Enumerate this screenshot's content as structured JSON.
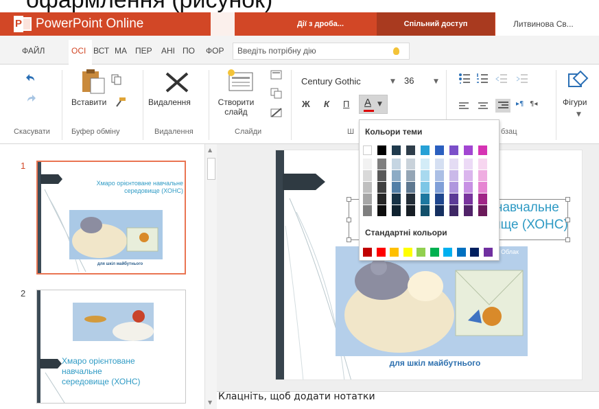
{
  "caption": "офармлення (рисунок)",
  "titlebar": {
    "app_name": "PowerPoint Online",
    "doc_button": "Дії з дроба...",
    "share_button": "Спільний доступ",
    "user": "Литвинова Св..."
  },
  "tabs": {
    "file": "ФАЙЛ",
    "home": "ОСІ",
    "others": [
      "ВСТ",
      "МА",
      "ПЕР",
      "АНІ",
      "ПО",
      "ФОР"
    ],
    "search_placeholder": "Введіть потрібну дію"
  },
  "ribbon": {
    "undo_group": "Скасувати",
    "clipboard_group": "Буфер обміну",
    "paste_label": "Вставити",
    "delete_group": "Видалення",
    "delete_label": "Видалення",
    "new_slide_label_1": "Створити",
    "new_slide_label_2": "слайд",
    "slides_group": "Слайди",
    "font_group": "Ш",
    "font_name": "Century Gothic",
    "font_size": "36",
    "bold": "Ж",
    "italic": "К",
    "underline": "П",
    "font_color_letter": "А",
    "para_group": "бзац",
    "shapes_label": "Фігури"
  },
  "color_popup": {
    "theme_header": "Кольори теми",
    "standard_header": "Стандартні кольори",
    "theme_columns": [
      [
        "#ffffff",
        "#f2f2f2",
        "#d9d9d9",
        "#bfbfbf",
        "#a6a6a6",
        "#7f7f7f"
      ],
      [
        "#000000",
        "#7f7f7f",
        "#595959",
        "#404040",
        "#262626",
        "#0d0d0d"
      ],
      [
        "#1f3a4d",
        "#c5d5e2",
        "#8cabc5",
        "#527fa7",
        "#173347",
        "#0f222f"
      ],
      [
        "#2e3d4a",
        "#c9d2da",
        "#94a5b5",
        "#5e7890",
        "#232e38",
        "#171e25"
      ],
      [
        "#27a1d6",
        "#d3ecf7",
        "#a8d9ef",
        "#7cc6e6",
        "#1d78a0",
        "#13506b"
      ],
      [
        "#2b5fbf",
        "#d5dff2",
        "#abbfe5",
        "#809fd8",
        "#20478f",
        "#153060"
      ],
      [
        "#7b4fc9",
        "#e4dcf4",
        "#cab9e9",
        "#af96de",
        "#5c3b97",
        "#3e2765"
      ],
      [
        "#a246d2",
        "#ecdaf6",
        "#dab5ed",
        "#c790e4",
        "#79349e",
        "#512369"
      ],
      [
        "#d633b4",
        "#f7d6f0",
        "#efade1",
        "#e685d2",
        "#a02687",
        "#6b1a5a"
      ]
    ],
    "standard_colors": [
      "#c00000",
      "#ff0000",
      "#ffc000",
      "#ffff00",
      "#92d050",
      "#00b050",
      "#00b0f0",
      "#0070c0",
      "#002060",
      "#7030a0"
    ]
  },
  "thumbnails": {
    "slide1_num": "1",
    "slide1_title": "Хмаро орієнтоване навчальне середовище (ХОНС)",
    "slide1_footer": "для шкіл майбутнього",
    "slide2_num": "2",
    "slide2_title_1": "Хмаро орієнтоване",
    "slide2_title_2": "навчальне",
    "slide2_title_3": "середовище (ХОНС)"
  },
  "main_slide": {
    "title_line1": "навчальне",
    "title_line2": "ище (ХОНС)",
    "footer": "для шкіл майбутнього",
    "badge": "Облак"
  },
  "notes": "Клацніть, щоб додати нотатки"
}
